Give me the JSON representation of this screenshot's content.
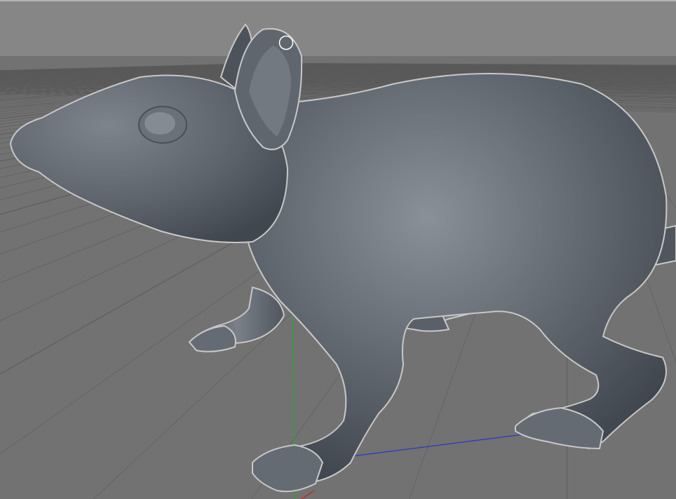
{
  "viewport": {
    "sky_color": "#868686",
    "floor_color": "#6e6e6e",
    "grid_line_color": "#5a5a5a",
    "model_color": "#5d636b",
    "outline_color": "#c8c8c8"
  },
  "axes": {
    "y_color": "#1fae2a",
    "z_color": "#2a36c8",
    "x_color": "#c82a2a"
  },
  "cursor": {
    "icon": "brush-circle-cursor",
    "color": "#ffffff"
  }
}
